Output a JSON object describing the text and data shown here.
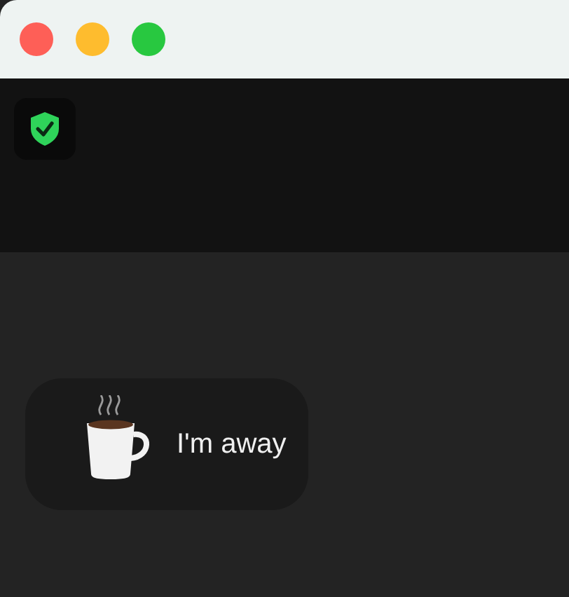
{
  "status": {
    "label": "I'm away"
  }
}
